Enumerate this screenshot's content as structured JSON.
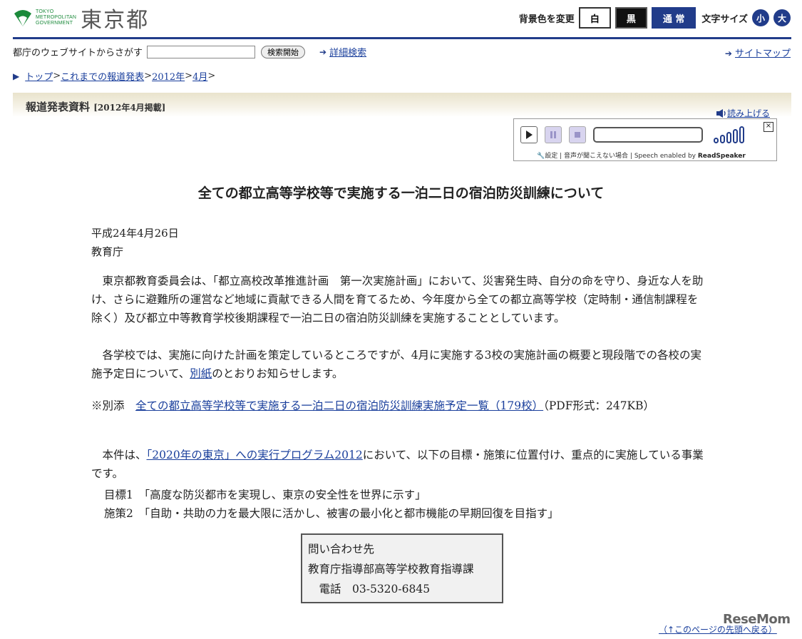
{
  "header": {
    "logo_small": [
      "TOKYO",
      "METROPOLITAN",
      "GOVERNMENT"
    ],
    "logo_kanji": "東京都",
    "bg_label": "背景色を変更",
    "bg_white": "白",
    "bg_black": "黒",
    "bg_normal": "通 常",
    "fontsize_label": "文字サイズ",
    "fontsize_small": "小",
    "fontsize_large": "大"
  },
  "search": {
    "label": "都庁のウェブサイトからさがす",
    "value": "",
    "button": "検索開始",
    "advanced": "詳細検索",
    "sitemap": "サイトマップ"
  },
  "breadcrumb": [
    "トップ",
    "これまでの報道発表",
    "2012年",
    "4月"
  ],
  "section": {
    "title": "報道発表資料",
    "date": "[2012年4月掲載]"
  },
  "readspeaker": {
    "link": "読み上げる",
    "close": "×",
    "settings": "設定",
    "sep1": "|",
    "help": "音声が聞こえない場合",
    "sep2": "|",
    "enabled": "Speech enabled by",
    "brand": "ReadSpeaker"
  },
  "article": {
    "title": "全ての都立高等学校等で実施する一泊二日の宿泊防災訓練について",
    "date": "平成24年4月26日",
    "org": "教育庁",
    "para1": "東京都教育委員会は、「都立高校改革推進計画　第一次実施計画」において、災害発生時、自分の命を守り、身近な人を助け、さらに避難所の運営など地域に貢献できる人間を育てるため、今年度から全ての都立高等学校（定時制・通信制課程を除く）及び都立中等教育学校後期課程で一泊二日の宿泊防災訓練を実施することとしています。",
    "para2_pre": "各学校では、実施に向けた計画を策定しているところですが、4月に実施する3校の実施計画の概要と現段階での各校の実施予定日について、",
    "para2_link": "別紙",
    "para2_post": "のとおりお知らせします。",
    "note_prefix": "※別添　",
    "note_link": "全ての都立高等学校等で実施する一泊二日の宿泊防災訓練実施予定一覧（179校）",
    "note_suffix": "（PDF形式：247KB）",
    "para3_pre": "本件は、",
    "para3_link": "「2020年の東京」への実行プログラム2012",
    "para3_post": "において、以下の目標・施策に位置付け、重点的に実施している事業です。",
    "goal1": "目標1　「高度な防災都市を実現し、東京の安全性を世界に示す」",
    "goal2": "施策2　「自助・共助の力を最大限に活かし、被害の最小化と都市機能の早期回復を目指す」"
  },
  "contact": {
    "heading": "問い合わせ先",
    "dept": "教育庁指導部高等学校教育指導課",
    "phone": "　電話　03-5320-6845"
  },
  "footer": {
    "back_to_top": "（↑このページの先頭へ戻る）",
    "watermark": "ReseMom"
  }
}
